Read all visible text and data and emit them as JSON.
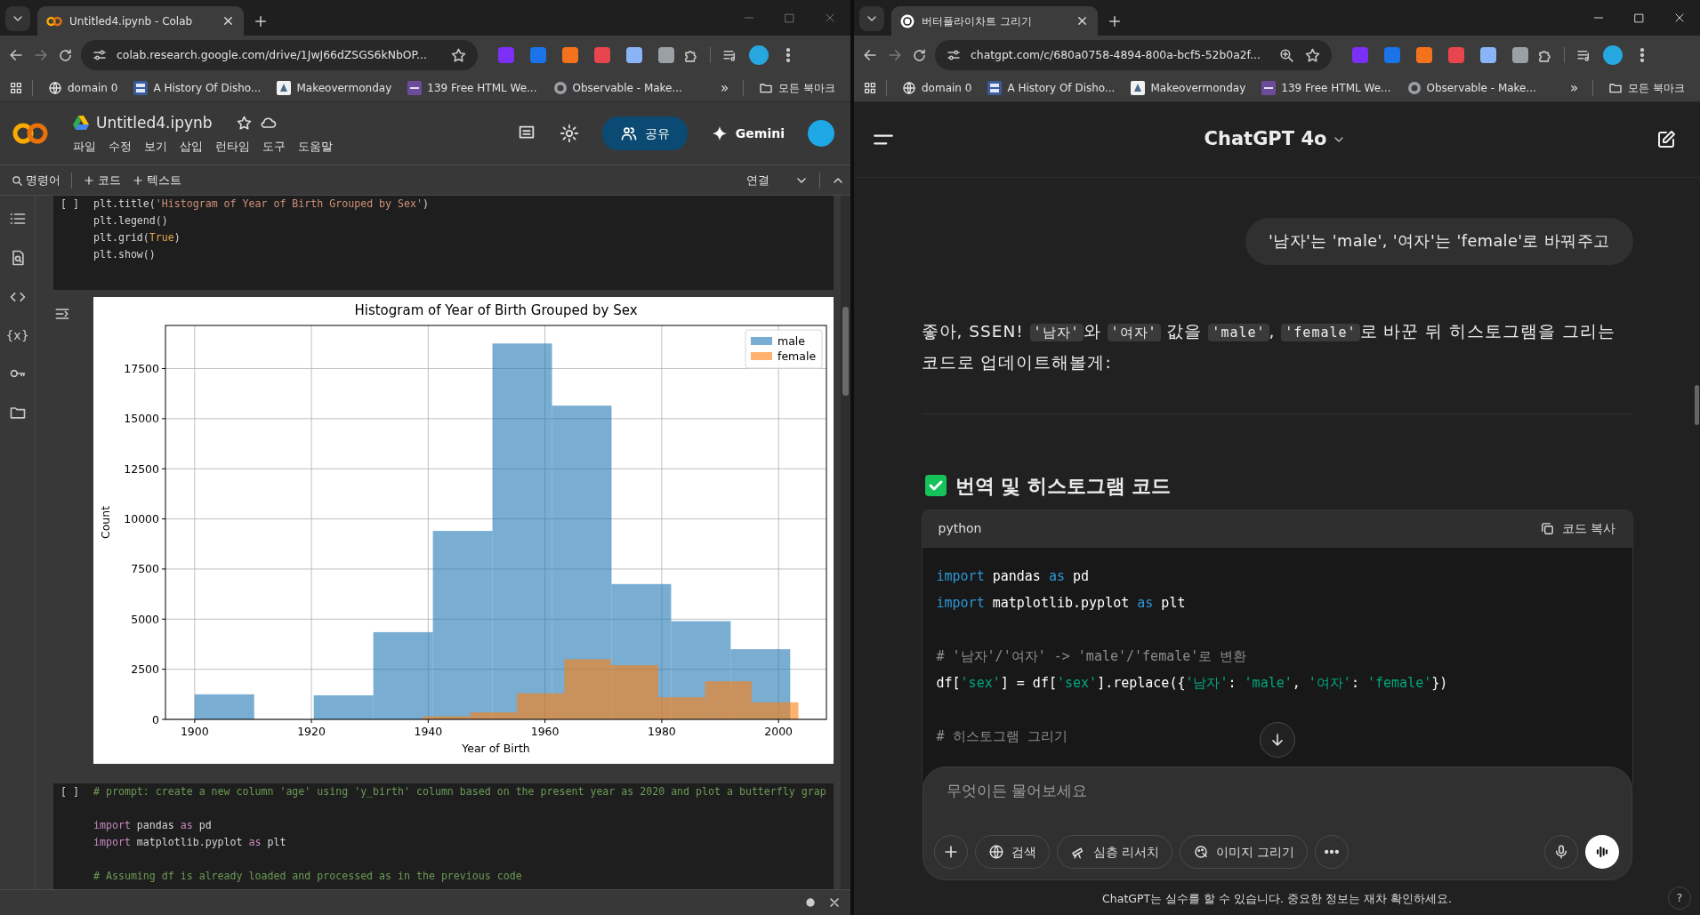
{
  "left_window": {
    "focused": false,
    "browser": {
      "tab_title": "Untitled4.ipynb - Colab",
      "address": "colab.research.google.com/drive/1JwJ66dZSGS6kNbOP...",
      "page_zoomed": false,
      "bookmarks": [
        "domain 0",
        "A History Of Disho...",
        "Makeovermonday",
        "139 Free HTML We...",
        "Observable - Make..."
      ],
      "more_bookmarks": "»",
      "all_bookmarks": "모든 북마크"
    },
    "colab": {
      "notebook_title": "Untitled4.ipynb",
      "menu": [
        "파일",
        "수정",
        "보기",
        "삽입",
        "런타임",
        "도구",
        "도움말"
      ],
      "share_label": "공유",
      "gemini_label": "Gemini",
      "toolbar": {
        "command_label": "명령어",
        "add_code": "코드",
        "add_text": "텍스트",
        "connect": "연결"
      },
      "sidebar": {
        "variables_label": "{x}"
      },
      "cells": [
        {
          "run_marker": "[ ]",
          "lines": [
            {
              "kind": "code",
              "tokens": [
                {
                  "text": "plt.title(",
                  "kind": "plain"
                },
                {
                  "text": "'Histogram of Year of Birth Grouped by Sex'",
                  "kind": "string"
                },
                {
                  "text": ")",
                  "kind": "plain"
                }
              ]
            },
            {
              "kind": "code",
              "tokens": [
                {
                  "text": "plt.legend()",
                  "kind": "plain"
                }
              ]
            },
            {
              "kind": "code",
              "tokens": [
                {
                  "text": "plt.grid(",
                  "kind": "plain"
                },
                {
                  "text": "True",
                  "kind": "constant"
                },
                {
                  "text": ")",
                  "kind": "plain"
                }
              ]
            },
            {
              "kind": "code",
              "tokens": [
                {
                  "text": "plt.show()",
                  "kind": "plain"
                }
              ]
            }
          ],
          "output": {
            "chart_data": {
              "type": "bar",
              "title": "Histogram of Year of Birth Grouped by Sex",
              "xlabel": "Year of Birth",
              "ylabel": "Count",
              "series": [
                {
                  "name": "male",
                  "color": "#1f77b4",
                  "x": [
                    1900,
                    1910.2,
                    1920.4,
                    1930.6,
                    1940.8,
                    1951,
                    1961.2,
                    1971.4,
                    1981.6,
                    1991.8
                  ],
                  "values": [
                    1250,
                    0,
                    1200,
                    4350,
                    9400,
                    18750,
                    15650,
                    6750,
                    4900,
                    3500
                  ]
                },
                {
                  "name": "female",
                  "color": "#ff7f0e",
                  "x": [
                    1939.1,
                    1947.2,
                    1955.2,
                    1963.3,
                    1971.3,
                    1979.4,
                    1987.4,
                    1995.4
                  ],
                  "values": [
                    150,
                    350,
                    1300,
                    3000,
                    2700,
                    1100,
                    1900,
                    850
                  ]
                }
              ],
              "grid": true,
              "legend": true,
              "xlim": [
                1895,
                2008.2
              ],
              "ylim": [
                0,
                19650
              ],
              "xticks": [
                1900,
                1920,
                1940,
                1960,
                1980,
                2000
              ],
              "yticks": [
                0,
                2500,
                5000,
                7500,
                10000,
                12500,
                15000,
                17500
              ]
            }
          }
        },
        {
          "run_marker": "[ ]",
          "lines": [
            {
              "kind": "code",
              "tokens": [
                {
                  "text": "# prompt: create a new column 'age' using 'y_birth' column based on the present year as 2020 and plot a butterfly grap",
                  "kind": "comment"
                }
              ]
            },
            {
              "kind": "blank"
            },
            {
              "kind": "code",
              "tokens": [
                {
                  "text": "import",
                  "kind": "keyword"
                },
                {
                  "text": " pandas ",
                  "kind": "plain"
                },
                {
                  "text": "as",
                  "kind": "keyword"
                },
                {
                  "text": " pd",
                  "kind": "plain"
                }
              ]
            },
            {
              "kind": "code",
              "tokens": [
                {
                  "text": "import",
                  "kind": "keyword"
                },
                {
                  "text": " matplotlib.pyplot ",
                  "kind": "plain"
                },
                {
                  "text": "as",
                  "kind": "keyword"
                },
                {
                  "text": " plt",
                  "kind": "plain"
                }
              ]
            },
            {
              "kind": "blank"
            },
            {
              "kind": "code",
              "tokens": [
                {
                  "text": "# Assuming df is already loaded and processed as in the previous code",
                  "kind": "comment"
                }
              ]
            }
          ]
        }
      ]
    }
  },
  "right_window": {
    "focused": true,
    "browser": {
      "tab_title": "버터플라이차트 그리기",
      "address": "chatgpt.com/c/680a0758-4894-800a-bcf5-52b0a2f...",
      "page_zoomed": true,
      "bookmarks": [
        "domain 0",
        "A History Of Disho...",
        "Makeovermonday",
        "139 Free HTML We...",
        "Observable - Make..."
      ],
      "more_bookmarks": "»",
      "all_bookmarks": "모든 북마크"
    },
    "chatgpt": {
      "model_title": "ChatGPT 4o",
      "messages": [
        {
          "kind": "user",
          "text": "'남자'는 'male', '여자'는 'female'로 바꿔주고"
        },
        {
          "kind": "assistant",
          "parts": [
            {
              "text": "좋아, SSEN! ",
              "kind": "text"
            },
            {
              "text": "'남자'",
              "kind": "code"
            },
            {
              "text": "와 ",
              "kind": "text"
            },
            {
              "text": "'여자'",
              "kind": "code"
            },
            {
              "text": " 값을 ",
              "kind": "text"
            },
            {
              "text": "'male'",
              "kind": "code"
            },
            {
              "text": ", ",
              "kind": "text"
            },
            {
              "text": "'female'",
              "kind": "code"
            },
            {
              "text": "로 바꾼 뒤 히스토그램을 그리는 코드로 업데이트해볼게:",
              "kind": "text"
            }
          ],
          "heading": "번역 및 히스토그램 코드",
          "code": {
            "language": "python",
            "copy_label": "코드 복사",
            "lines": [
              {
                "kind": "code",
                "tokens": [
                  {
                    "text": "import",
                    "kind": "keyword"
                  },
                  {
                    "text": " pandas ",
                    "kind": "plain"
                  },
                  {
                    "text": "as",
                    "kind": "keyword"
                  },
                  {
                    "text": " pd",
                    "kind": "plain"
                  }
                ]
              },
              {
                "kind": "code",
                "tokens": [
                  {
                    "text": "import",
                    "kind": "keyword"
                  },
                  {
                    "text": " matplotlib.pyplot ",
                    "kind": "plain"
                  },
                  {
                    "text": "as",
                    "kind": "keyword"
                  },
                  {
                    "text": " plt",
                    "kind": "plain"
                  }
                ]
              },
              {
                "kind": "blank"
              },
              {
                "kind": "code",
                "tokens": [
                  {
                    "text": "# '남자'/'여자' -> 'male'/'female'로 변환",
                    "kind": "comment"
                  }
                ]
              },
              {
                "kind": "code",
                "tokens": [
                  {
                    "text": "df[",
                    "kind": "plain"
                  },
                  {
                    "text": "'sex'",
                    "kind": "string"
                  },
                  {
                    "text": "] = df[",
                    "kind": "plain"
                  },
                  {
                    "text": "'sex'",
                    "kind": "string"
                  },
                  {
                    "text": "].replace({",
                    "kind": "plain"
                  },
                  {
                    "text": "'남자'",
                    "kind": "string"
                  },
                  {
                    "text": ": ",
                    "kind": "plain"
                  },
                  {
                    "text": "'male'",
                    "kind": "string"
                  },
                  {
                    "text": ", ",
                    "kind": "plain"
                  },
                  {
                    "text": "'여자'",
                    "kind": "string"
                  },
                  {
                    "text": ": ",
                    "kind": "plain"
                  },
                  {
                    "text": "'female'",
                    "kind": "string"
                  },
                  {
                    "text": "})",
                    "kind": "plain"
                  }
                ]
              },
              {
                "kind": "blank"
              },
              {
                "kind": "code",
                "tokens": [
                  {
                    "text": "# 히스토그램 그리기",
                    "kind": "comment"
                  }
                ]
              }
            ]
          }
        }
      ],
      "composer": {
        "placeholder": "무엇이든 물어보세요",
        "tools": [
          "검색",
          "심층 리서치",
          "이미지 그리기"
        ]
      },
      "disclaimer": "ChatGPT는 실수를 할 수 있습니다. 중요한 정보는 재차 확인하세요.",
      "help": "?"
    }
  }
}
